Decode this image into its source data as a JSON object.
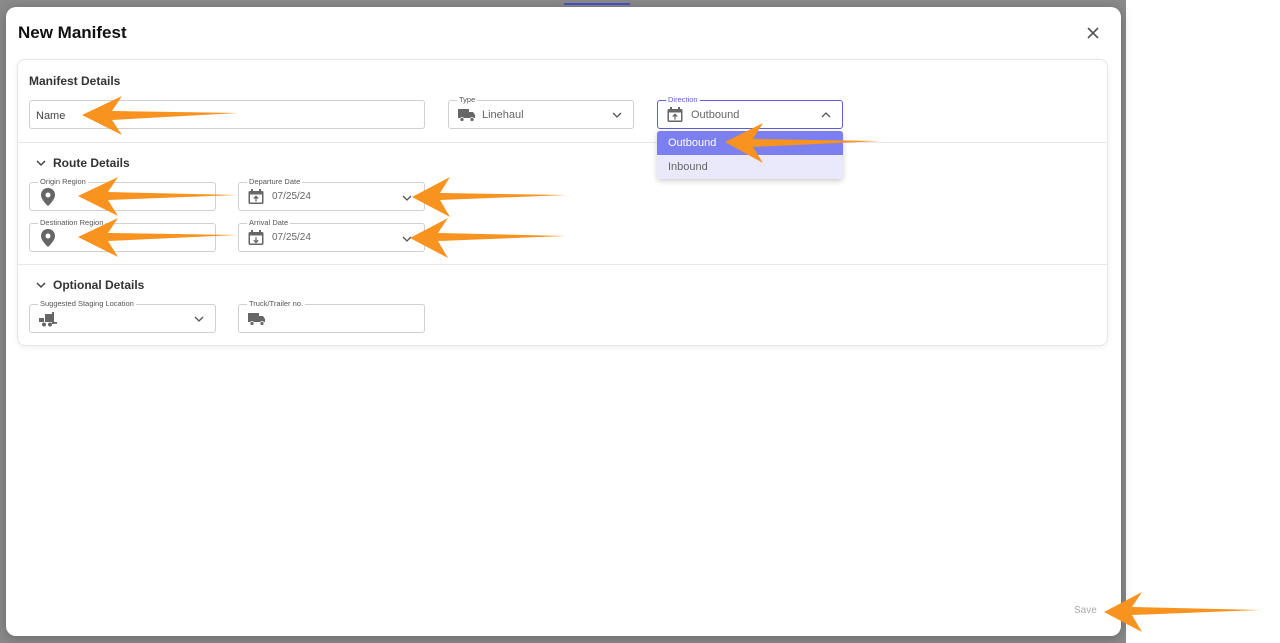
{
  "modal": {
    "title": "New Manifest",
    "save_label": "Save"
  },
  "manifest_details": {
    "title": "Manifest Details",
    "name_placeholder": "Name",
    "type": {
      "label": "Type",
      "value": "Linehaul"
    },
    "direction": {
      "label": "Direction",
      "value": "Outbound",
      "options": [
        "Outbound",
        "Inbound"
      ]
    }
  },
  "route_details": {
    "title": "Route Details",
    "origin_label": "Origin Region",
    "destination_label": "Destination Region",
    "departure": {
      "label": "Departure Date",
      "value": "07/25/24"
    },
    "arrival": {
      "label": "Arrival Date",
      "value": "07/25/24"
    }
  },
  "optional_details": {
    "title": "Optional Details",
    "staging_label": "Suggested Staging Location",
    "truck_label": "Truck/Trailer no."
  },
  "colors": {
    "accent": "#5b5fe0",
    "arrow": "#f7931e"
  }
}
